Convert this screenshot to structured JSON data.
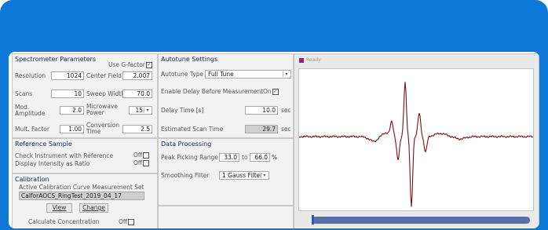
{
  "spectrometer": {
    "title": "Spectrometer Parameters",
    "use_g_factor_label": "Use G-factor",
    "use_g_factor_checked": true,
    "resolution_label": "Resolution",
    "resolution_value": "1024",
    "center_field_label": "Center Field",
    "center_field_value": "2.007",
    "scans_label": "Scans",
    "scans_value": "10",
    "sweep_width_label": "Sweep Width",
    "sweep_width_value": "70.0",
    "mod_amplitude_label_1": "Mod.",
    "mod_amplitude_label_2": "Amplitude",
    "mod_amplitude_value": "2.0",
    "microwave_power_label_1": "Microwave",
    "microwave_power_label_2": "Power",
    "microwave_power_value": "15",
    "mult_factor_label": "Mult. Factor",
    "mult_factor_value": "1.00",
    "conversion_time_label_1": "Conversion",
    "conversion_time_label_2": "Time",
    "conversion_time_value": "2.5"
  },
  "reference": {
    "title": "Reference Sample",
    "check_instrument_label": "Check Instrument with Reference",
    "check_instrument_state": "Off",
    "display_ratio_label": "Display Intensity as Ratio",
    "display_ratio_state": "Off"
  },
  "calibration": {
    "title": "Calibration",
    "active_curve_label": "Active Calibration Curve Measurement Set",
    "active_curve_value": "CalforAOCS_RingTest_2019_04_17",
    "view_label": "View",
    "change_label": "Change",
    "calc_concentration_label": "Calculate Concentration",
    "calc_concentration_state": "Off"
  },
  "autotune": {
    "title": "Autotune Settings",
    "type_label": "Autotune Type",
    "type_value": "Full Tune",
    "enable_delay_label": "Enable Delay Before Measurement",
    "enable_delay_state": "On",
    "delay_time_label": "Delay Time [s]",
    "delay_time_value": "10.0",
    "delay_time_unit": "sec",
    "est_scan_label": "Estimated Scan Time",
    "est_scan_value": "29.7",
    "est_scan_unit": "sec"
  },
  "processing": {
    "title": "Data Processing",
    "peak_range_label": "Peak Picking Range",
    "peak_from": "33.0",
    "peak_to_label": "to",
    "peak_to": "66.0",
    "peak_unit": "%",
    "smoothing_label": "Smoothing Filter",
    "smoothing_value": "1 Gauss Filter"
  },
  "spectrum": {
    "status_label": "Ready",
    "progress_fraction": 1.0,
    "line_color": "#7a1010",
    "status_icon_color": "#8a2a6a"
  },
  "colors": {
    "frame_blue": "#0e78d8",
    "section_title": "#1a2a66",
    "progress_blue": "#5a6ea8"
  }
}
